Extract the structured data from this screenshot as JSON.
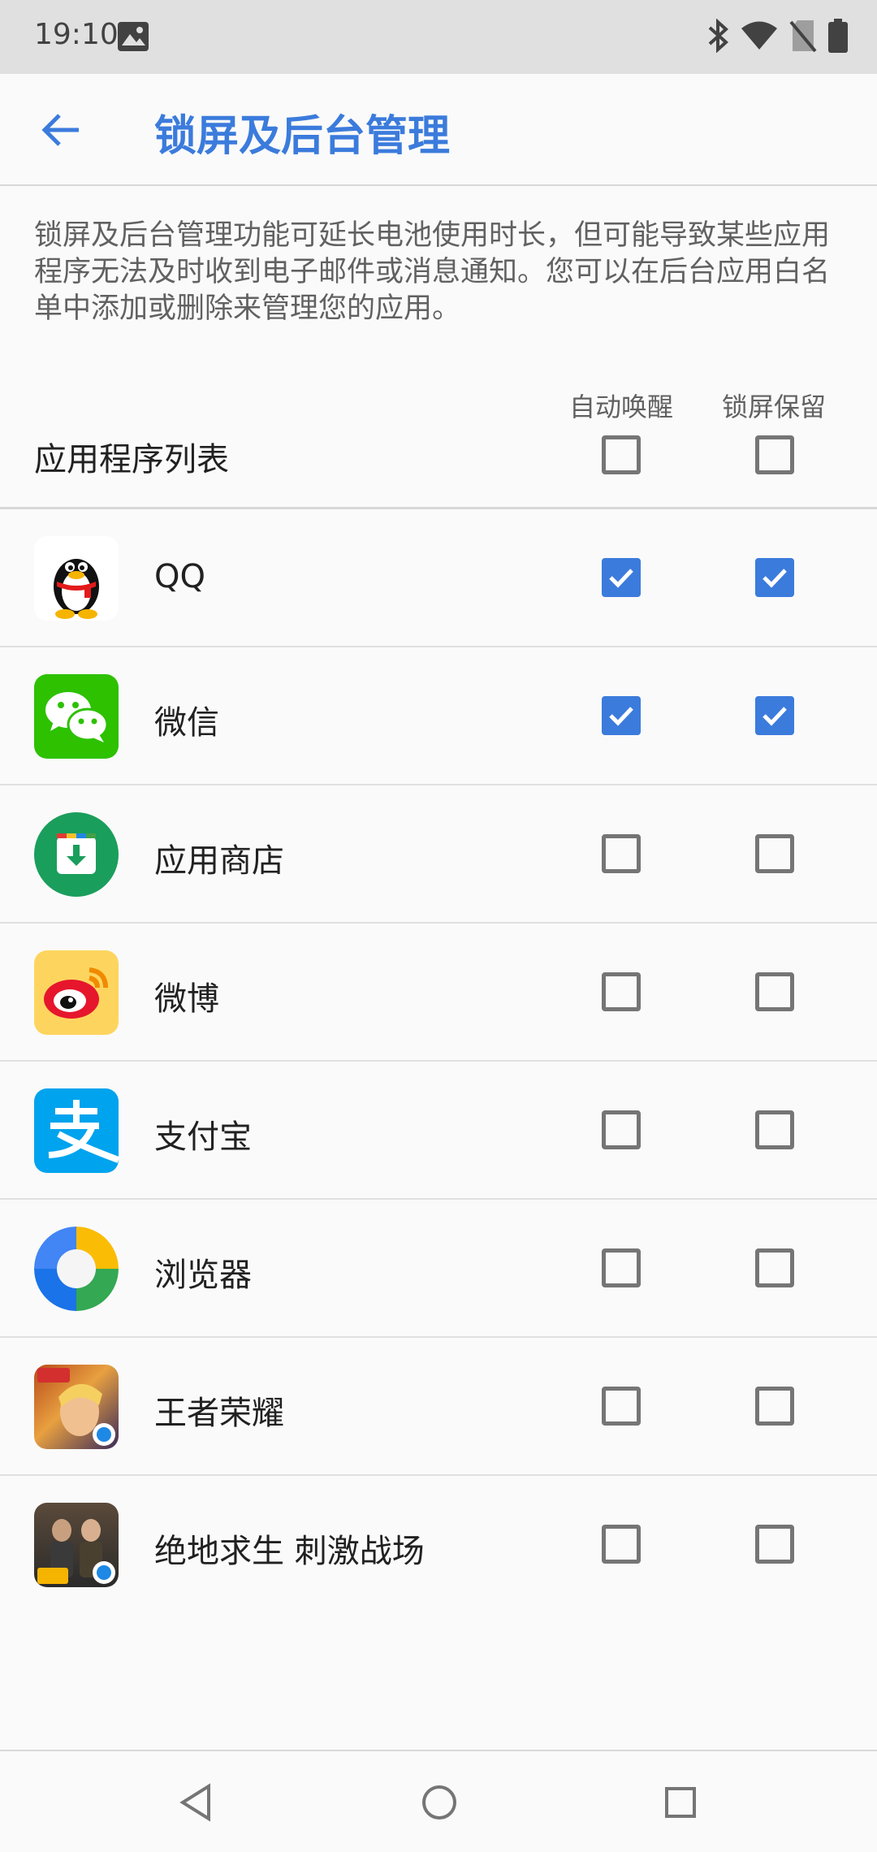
{
  "status_bar": {
    "time": "19:10",
    "icons": [
      "image-icon",
      "bluetooth-icon",
      "wifi-icon",
      "no-sim-icon",
      "battery-icon"
    ]
  },
  "app_bar": {
    "title": "锁屏及后台管理",
    "back_icon": "arrow-left-icon",
    "accent_color": "#3b7bdc"
  },
  "description": "锁屏及后台管理功能可延长电池使用时长，但可能导致某些应用程序无法及时收到电子邮件或消息通知。您可以在后台应用白名单中添加或删除来管理您的应用。",
  "list_header": {
    "title": "应用程序列表",
    "col_wake": "自动唤醒",
    "col_lock": "锁屏保留",
    "all_wake_checked": false,
    "all_lock_checked": false
  },
  "apps": [
    {
      "name": "QQ",
      "icon": "qq-icon",
      "auto_wake": true,
      "lock_keep": true
    },
    {
      "name": "微信",
      "icon": "wechat-icon",
      "auto_wake": true,
      "lock_keep": true
    },
    {
      "name": "应用商店",
      "icon": "app-store-icon",
      "auto_wake": false,
      "lock_keep": false
    },
    {
      "name": "微博",
      "icon": "weibo-icon",
      "auto_wake": false,
      "lock_keep": false
    },
    {
      "name": "支付宝",
      "icon": "alipay-icon",
      "auto_wake": false,
      "lock_keep": false
    },
    {
      "name": "浏览器",
      "icon": "browser-icon",
      "auto_wake": false,
      "lock_keep": false
    },
    {
      "name": "王者荣耀",
      "icon": "honor-of-kings-icon",
      "auto_wake": false,
      "lock_keep": false
    },
    {
      "name": "绝地求生 刺激战场",
      "icon": "pubg-icon",
      "auto_wake": false,
      "lock_keep": false
    }
  ],
  "nav_bar": {
    "back": "nav-back-icon",
    "home": "nav-home-icon",
    "recents": "nav-recents-icon"
  }
}
